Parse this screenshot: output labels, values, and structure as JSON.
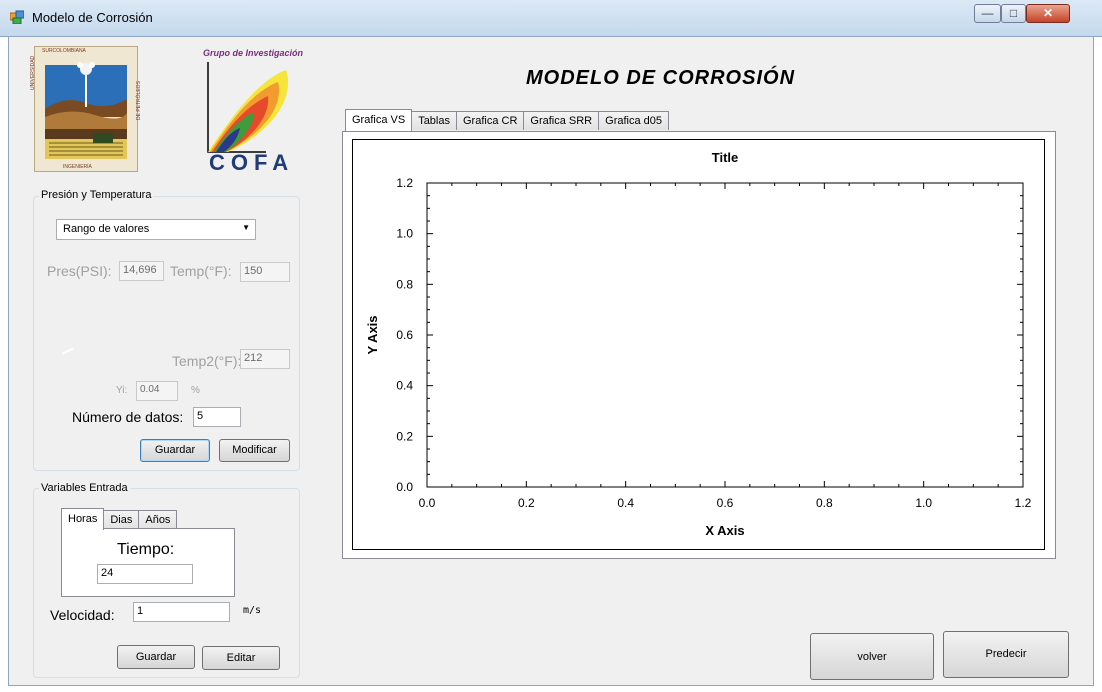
{
  "window": {
    "title": "Modelo de Corrosión",
    "controls": [
      "minimize-icon",
      "maximize-icon",
      "close-icon"
    ]
  },
  "logos": {
    "usco": {
      "top": "SURCOLOMBIANA",
      "left": "UNIVERSIDAD",
      "right": "DE PETRÓLEOS",
      "bottom": "INGENIERÍA"
    },
    "cofa": {
      "caption": "Grupo de Investigación",
      "name": "COFA"
    }
  },
  "pressure_group": {
    "title": "Presión y Temperatura",
    "mode_select": "Rango de valores",
    "pres_label": "Pres(PSI):",
    "pres_value": "14,696",
    "temp_label": "Temp(°F):",
    "temp_value": "150",
    "temp2_label": "Temp2(°F):",
    "temp2_value": "212",
    "yi_label": "Yi:",
    "yi_value": "0.04",
    "yi_unit": "%",
    "num_datos_label": "Número de datos:",
    "num_datos_value": "5",
    "save_label": "Guardar",
    "modify_label": "Modificar"
  },
  "input_group": {
    "title": "Variables Entrada",
    "tabs": [
      "Horas",
      "Dias",
      "Años"
    ],
    "active_tab": "Horas",
    "tiempo_label": "Tiempo:",
    "tiempo_value": "24",
    "velocidad_label": "Velocidad:",
    "velocidad_value": "1",
    "velocidad_unit": "m/s",
    "save_label": "Guardar",
    "edit_label": "Editar"
  },
  "main": {
    "heading": "MODELO DE CORROSIÓN",
    "tabs": [
      "Grafica VS",
      "Tablas",
      "Grafica CR",
      "Grafica SRR",
      "Grafica d05"
    ],
    "active_tab": "Grafica VS"
  },
  "buttons": {
    "back": "volver",
    "predict": "Predecir"
  },
  "chart_data": {
    "type": "line",
    "title": "Title",
    "xlabel": "X Axis",
    "ylabel": "Y Axis",
    "xlim": [
      0,
      1.2
    ],
    "ylim": [
      0,
      1.2
    ],
    "x_ticks": [
      "0.0",
      "0.2",
      "0.4",
      "0.6",
      "0.8",
      "1.0",
      "1.2"
    ],
    "y_ticks": [
      "0.0",
      "0.2",
      "0.4",
      "0.6",
      "0.8",
      "1.0",
      "1.2"
    ],
    "series": [],
    "grid": false
  }
}
